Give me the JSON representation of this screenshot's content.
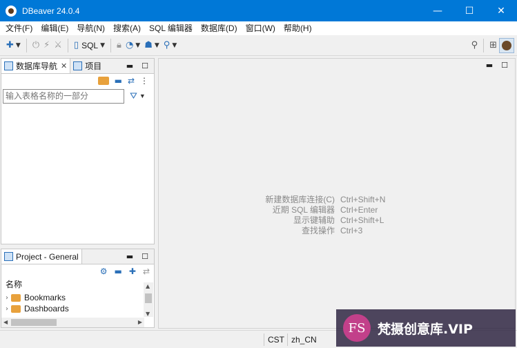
{
  "window": {
    "title": "DBeaver 24.0.4",
    "minimize_glyph": "—",
    "maximize_glyph": "☐",
    "close_glyph": "✕"
  },
  "menu": [
    "文件(F)",
    "编辑(E)",
    "导航(N)",
    "搜索(A)",
    "SQL 编辑器",
    "数据库(D)",
    "窗口(W)",
    "帮助(H)"
  ],
  "toolbar": {
    "sql_label": "SQL",
    "icons": [
      "new-connection-icon",
      "connect-plug-icon",
      "disconnect-icon",
      "disconnect-all-icon",
      "sql-editor-icon",
      "lock-icon",
      "dashboard-gauge-icon",
      "network-icon",
      "search-icon",
      "perspective-icon",
      "user-avatar-icon"
    ]
  },
  "navigator": {
    "tab_db": "数据库导航",
    "tab_project": "项目",
    "filter_placeholder": "输入表格名称的一部分"
  },
  "project_panel": {
    "tab": "Project - General",
    "column_header": "名称",
    "items": [
      "Bookmarks",
      "Dashboards"
    ]
  },
  "editor": {
    "hints": [
      {
        "label": "新建数据库连接(C)",
        "key": "Ctrl+Shift+N"
      },
      {
        "label": "近期 SQL 编辑器",
        "key": "Ctrl+Enter"
      },
      {
        "label": "显示键辅助",
        "key": "Ctrl+Shift+L"
      },
      {
        "label": "查找操作",
        "key": "Ctrl+3"
      }
    ]
  },
  "statusbar": {
    "timezone": "CST",
    "locale": "zh_CN"
  },
  "watermark": {
    "logo": "FS",
    "text": "梵摄创意库.VIP"
  }
}
